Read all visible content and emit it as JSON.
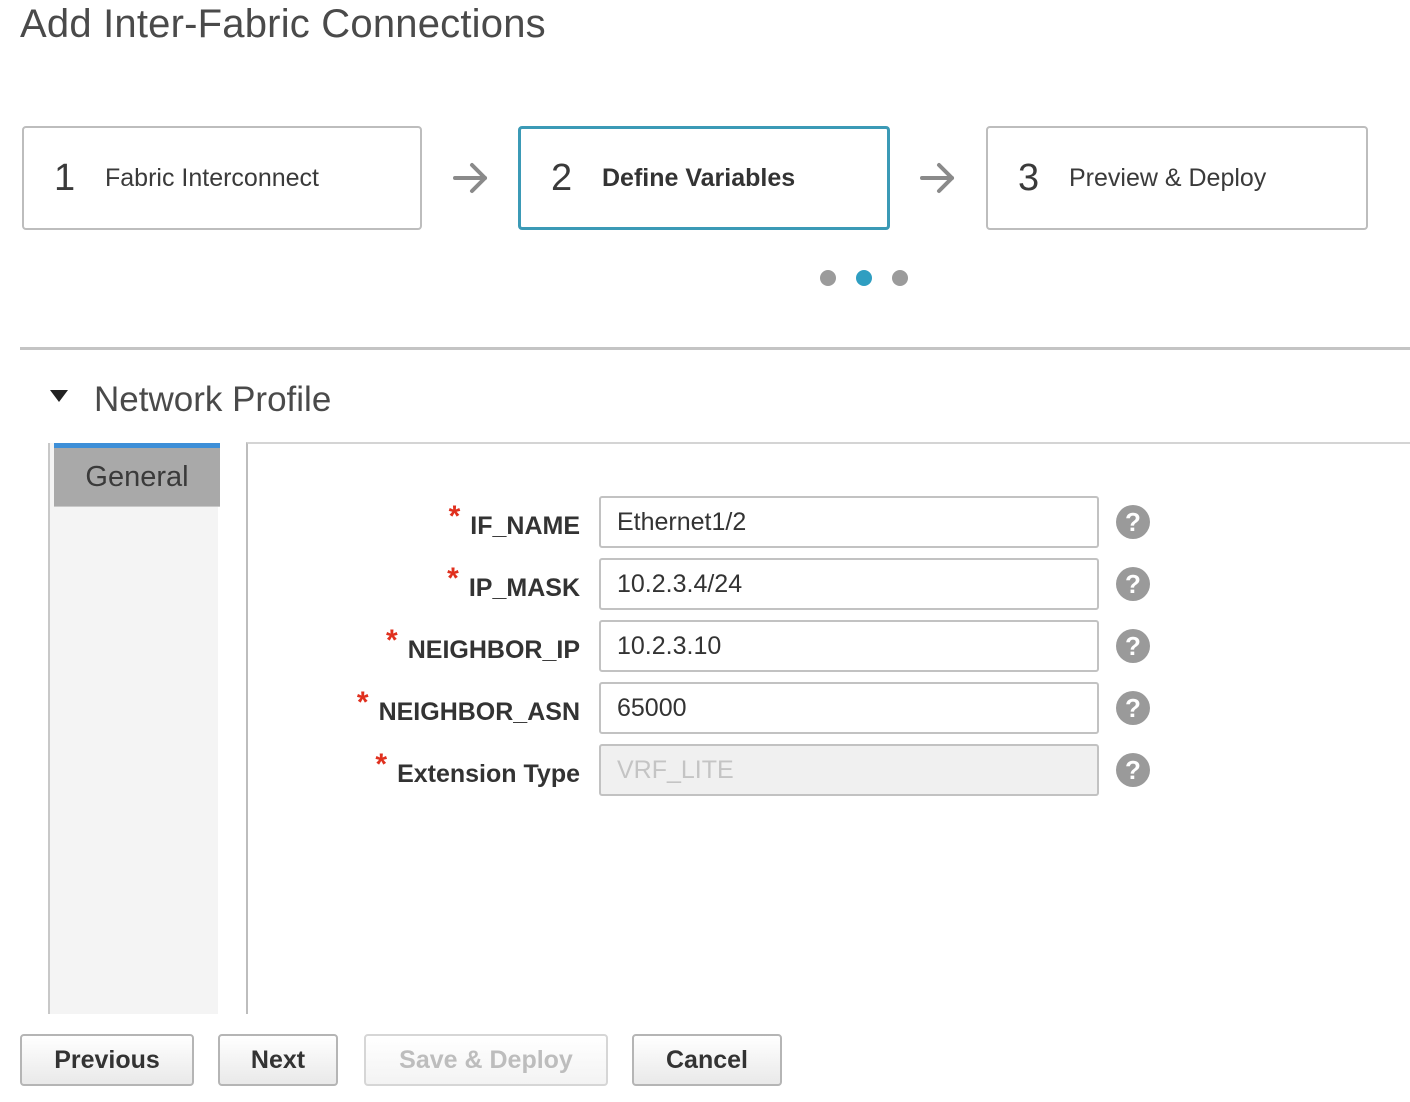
{
  "page": {
    "title": "Add Inter-Fabric Connections"
  },
  "wizard": {
    "steps": [
      {
        "number": "1",
        "label": "Fabric Interconnect",
        "active": false
      },
      {
        "number": "2",
        "label": "Define Variables",
        "active": true
      },
      {
        "number": "3",
        "label": "Preview & Deploy",
        "active": false
      }
    ],
    "progress": {
      "current_step": 2,
      "total_steps": 3
    }
  },
  "section": {
    "title": "Network Profile",
    "tabs": [
      {
        "label": "General",
        "selected": true
      }
    ]
  },
  "form": {
    "fields": [
      {
        "label": "IF_NAME",
        "value": "Ethernet1/2",
        "required": true,
        "disabled": false
      },
      {
        "label": "IP_MASK",
        "value": "10.2.3.4/24",
        "required": true,
        "disabled": false
      },
      {
        "label": "NEIGHBOR_IP",
        "value": "10.2.3.10",
        "required": true,
        "disabled": false
      },
      {
        "label": "NEIGHBOR_ASN",
        "value": "65000",
        "required": true,
        "disabled": false
      },
      {
        "label": "Extension Type",
        "value": "VRF_LITE",
        "required": true,
        "disabled": true
      }
    ],
    "required_marker": "*",
    "help_glyph": "?"
  },
  "footer": {
    "previous_label": "Previous",
    "next_label": "Next",
    "save_deploy_label": "Save & Deploy",
    "cancel_label": "Cancel"
  },
  "colors": {
    "active_step_border": "#3b9ab6",
    "active_dot": "#2f9ec1",
    "required_star": "#e0301e",
    "tab_indicator": "#3d8fd8"
  },
  "icons": {
    "step_arrow": "arrow-right-icon",
    "collapse": "caret-down-icon",
    "help": "question-circle-icon"
  }
}
